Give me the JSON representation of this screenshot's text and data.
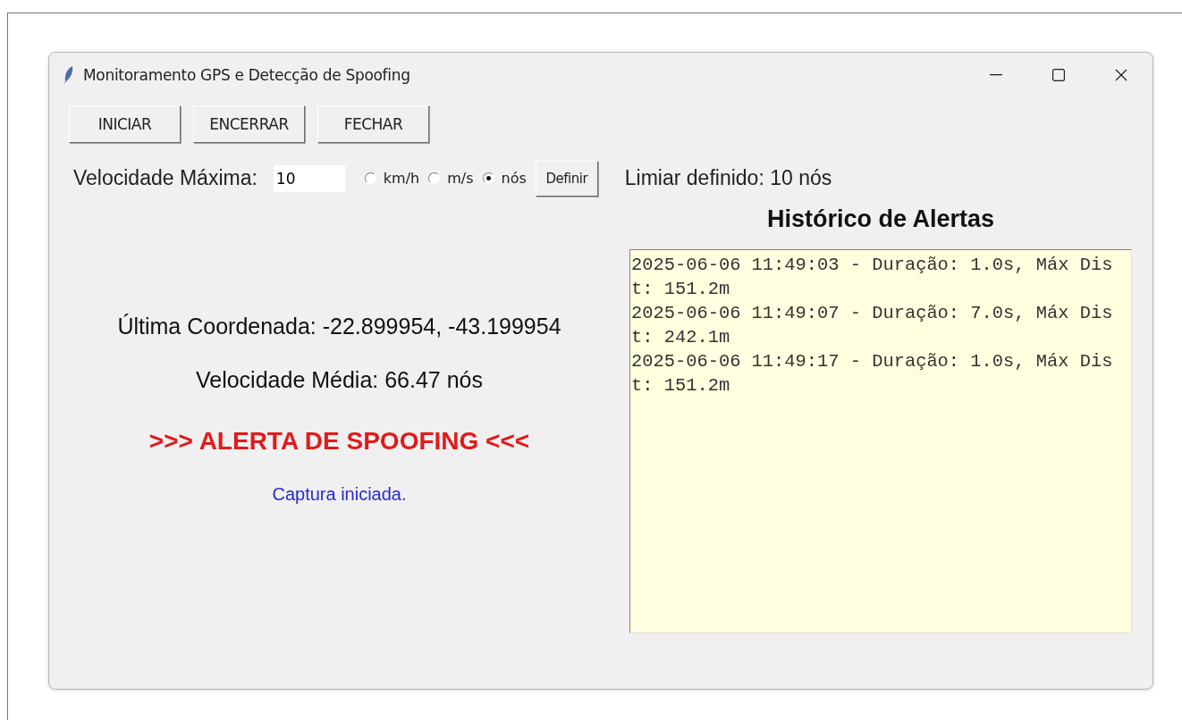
{
  "window": {
    "title": "Monitoramento GPS e Detecção de Spoofing"
  },
  "buttons": [
    "INICIAR",
    "ENCERRAR",
    "FECHAR"
  ],
  "speed_limit": {
    "label": "Velocidade Máxima:",
    "value": "10",
    "units": [
      {
        "label": "km/h",
        "selected": false
      },
      {
        "label": "m/s",
        "selected": false
      },
      {
        "label": "nós",
        "selected": true
      }
    ],
    "set_button": "Definir",
    "status": "Limiar definido: 10 nós"
  },
  "status_panel": [
    {
      "kind": "info",
      "text": "Última Coordenada: -22.899954, -43.199954"
    },
    {
      "kind": "info",
      "text": "Velocidade Média: 66.47 nós"
    },
    {
      "kind": "alert",
      "text": ">>> ALERTA DE SPOOFING <<<"
    },
    {
      "kind": "message",
      "text": "Captura iniciada."
    }
  ],
  "alert_history": {
    "title": "Histórico de Alertas",
    "entries": [
      "2025-06-06 11:49:03 - Duração: 1.0s, Máx Dist: 151.2m",
      "2025-06-06 11:49:07 - Duração: 7.0s, Máx Dist: 242.1m",
      "2025-06-06 11:49:17 - Duração: 1.0s, Máx Dist: 151.2m"
    ]
  }
}
